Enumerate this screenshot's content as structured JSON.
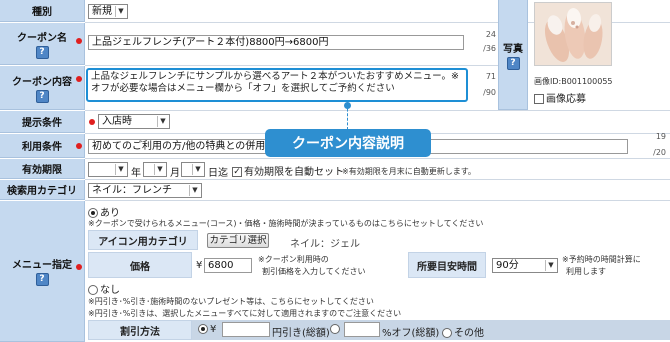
{
  "rows": {
    "type": {
      "label": "種別",
      "value": "新規"
    },
    "coupon_name": {
      "label": "クーポン名",
      "value": "上品ジェルフレンチ(アート２本付)8800円→6800円",
      "count": "24",
      "max": "/36"
    },
    "coupon_content": {
      "label": "クーポン内容",
      "value": "上品なジェルフレンチにサンプルから選べるアート２本がついたおすすめメニュー。※オフが必要な場合はメニュー欄から「オフ」を選択してご予約ください",
      "count": "71",
      "max": "/90"
    },
    "photo": {
      "label": "写真",
      "image_id": "画像ID:B001100055",
      "apply_label": "画像応募"
    },
    "display": {
      "label": "提示条件",
      "value": "入店時"
    },
    "usage": {
      "label": "利用条件",
      "value": "初めてのご利用の方/他の特典との併用不可",
      "count": "19",
      "max": "/20"
    },
    "expiry": {
      "label": "有効期限",
      "year_unit": "年",
      "month_unit": "月",
      "day_label": "日迄",
      "auto_set_label": "有効期限を自動セット",
      "auto_note": "※有効期限を月末に自動更新します。"
    },
    "category": {
      "label": "検索用カテゴリ",
      "value": "ネイル：フレンチ"
    },
    "menu": {
      "label": "メニュー指定",
      "option_yes": "あり",
      "yes_note": "※クーポンで受けられるメニュー(コース)・価格・施術時間が決まっているものはこちらにセットしてください",
      "icon_cat_label": "アイコン用カテゴリ",
      "cat_select_button": "カテゴリ選択",
      "cat_value": "ネイル：ジェル",
      "price_label": "価格",
      "price_prefix": "¥",
      "price_value": "6800",
      "price_note1": "※クーポン利用時の",
      "price_note2": "割引価格を入力してください",
      "time_label": "所要目安時間",
      "time_value": "90分",
      "time_note1": "※予約時の時間計算に",
      "time_note2": "利用します",
      "option_no": "なし",
      "no_note1": "※円引き･%引き･施術時間のないプレゼント等は、こちらにセットしてください",
      "no_note2": "※円引き･%引きは、選択したメニューすべてに対して適用されますのでご注意ください",
      "discount_label": "割引方法",
      "disc_yen_prefix": "¥",
      "disc_yen_suffix": "円引き(総額)",
      "disc_pct_suffix": "%オフ(総額)",
      "disc_other": "その他"
    }
  },
  "callout": {
    "label": "クーポン内容説明"
  },
  "colors": {
    "label_bg": "#c5d9ef",
    "required_dot": "#e01f1f",
    "callout": "#2e8fd0",
    "highlight": "#1e8fd5"
  }
}
